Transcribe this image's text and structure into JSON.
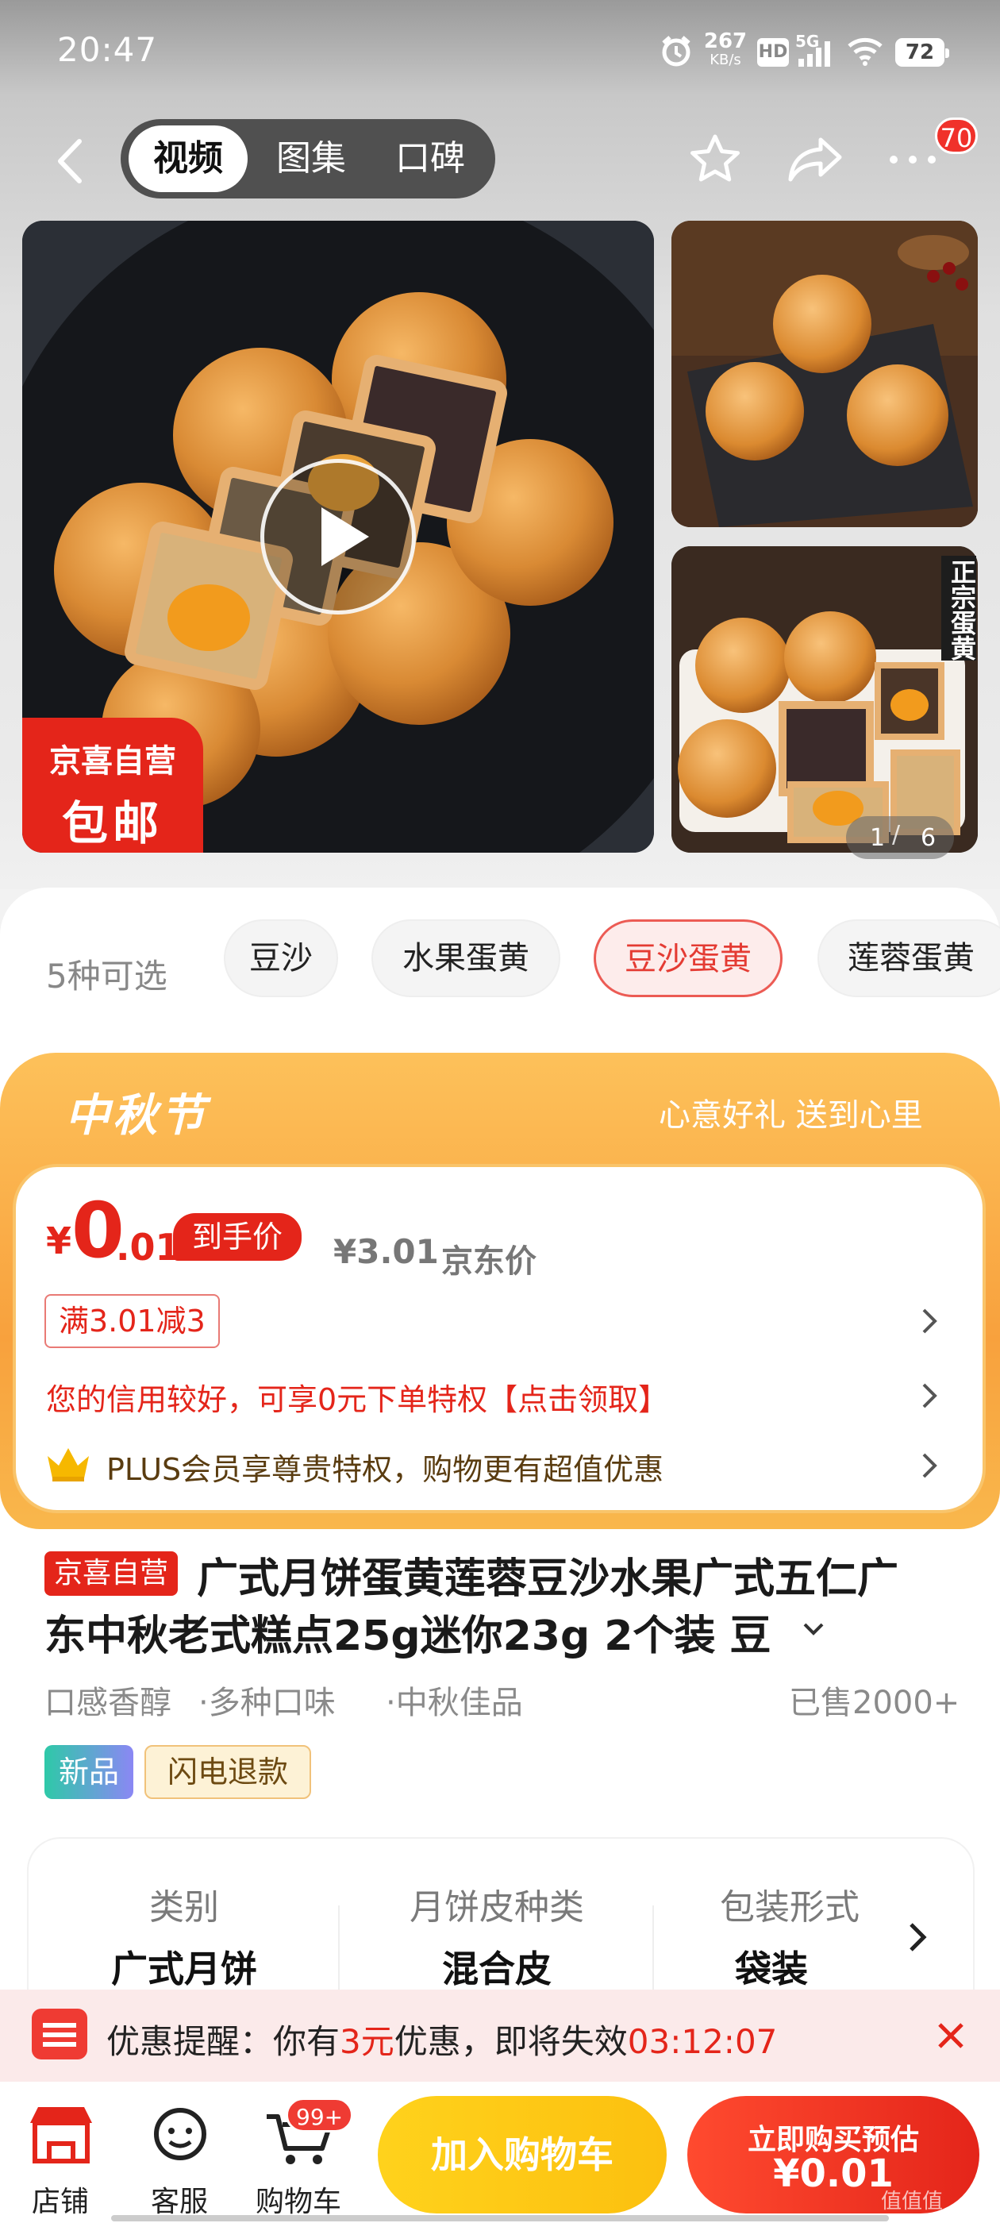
{
  "status_bar": {
    "time": "20:47",
    "speed": "267",
    "speed_unit": "KB/s",
    "hd": "HD",
    "network": "5G",
    "battery": "72"
  },
  "nav": {
    "tabs": [
      "视频",
      "图集",
      "口碑"
    ],
    "more_badge": "70"
  },
  "gallery": {
    "promo_line1": "京喜自营",
    "promo_line2": "包邮",
    "side_label": "正宗蛋黄",
    "counter_current": "1",
    "counter_total": "6"
  },
  "options": {
    "count_label": "5种可选",
    "chips": [
      "豆沙",
      "水果蛋黄",
      "豆沙蛋黄",
      "莲蓉蛋黄"
    ],
    "selected": "豆沙蛋黄"
  },
  "festival": {
    "title": "中秋节",
    "slogan": "心意好礼 送到心里"
  },
  "price": {
    "currency": "¥",
    "integer": "0",
    "decimal": ".01",
    "tag": "到手价",
    "jd_price": "¥3.01",
    "jd_price_label": "京东价",
    "coupon": "满3.01减3",
    "credit_text": "您的信用较好，可享0元下单特权【点击领取】",
    "plus_text": "PLUS会员享尊贵特权，购物更有超值优惠"
  },
  "product": {
    "title_tag": "京喜自营",
    "title_line1": "广式月饼蛋黄莲蓉豆沙水果广式五仁广",
    "title_line2": "东中秋老式糕点25g迷你23g 2个装 豆",
    "features": [
      "口感香醇",
      "·多种口味",
      "·中秋佳品"
    ],
    "sold": "已售2000+",
    "tag_new": "新品",
    "tag_refund": "闪电退款"
  },
  "specs": [
    {
      "label": "类别",
      "value": "广式月饼"
    },
    {
      "label": "月饼皮种类",
      "value": "混合皮"
    },
    {
      "label": "包装形式",
      "value": "袋装"
    }
  ],
  "reminder": {
    "prefix": "优惠提醒：你有",
    "amount": "3元",
    "middle": "优惠，即将失效",
    "countdown": "03:12:07"
  },
  "bottom": {
    "shop": "店铺",
    "service": "客服",
    "cart": "购物车",
    "cart_badge": "99+",
    "add_cart": "加入购物车",
    "buy_line1": "立即购买预估",
    "buy_line2": "¥0.01",
    "watermark": "值值值"
  },
  "colors": {
    "accent_red": "#e4251a",
    "festival_orange": "#f8a13d",
    "cart_yellow": "#fcc00f"
  }
}
